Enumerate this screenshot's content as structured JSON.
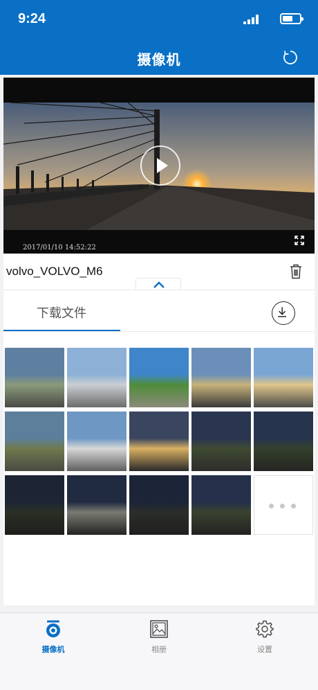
{
  "status_bar": {
    "time": "9:24",
    "battery_level": 0.6
  },
  "header": {
    "title": "摄像机"
  },
  "video": {
    "timestamp": "2017/01/10  14:52:22"
  },
  "file": {
    "name": "volvo_VOLVO_M6"
  },
  "tabs": {
    "download_label": "下载文件"
  },
  "thumbnails": [
    {
      "top": "#5f7fa0",
      "mid": "#8a9a7a",
      "bottom": "#4a4a45"
    },
    {
      "top": "#8db1d6",
      "mid": "#c9cfd3",
      "bottom": "#6b6b6b"
    },
    {
      "top": "#3e86c9",
      "mid": "#4f8c3a",
      "bottom": "#8a8a7a"
    },
    {
      "top": "#6b8fb8",
      "mid": "#c7b27a",
      "bottom": "#3a3a3a"
    },
    {
      "top": "#7aa6d4",
      "mid": "#e0c58a",
      "bottom": "#4b4b48"
    },
    {
      "top": "#5d7f9c",
      "mid": "#6f7a4e",
      "bottom": "#4a4a42"
    },
    {
      "top": "#6f97c4",
      "mid": "#d7d7d7",
      "bottom": "#5f5f5f"
    },
    {
      "top": "#3a4660",
      "mid": "#d9b062",
      "bottom": "#2a2a2a"
    },
    {
      "top": "#2a3550",
      "mid": "#3f4a32",
      "bottom": "#2d2d2b"
    },
    {
      "top": "#27344d",
      "mid": "#34402c",
      "bottom": "#252523"
    },
    {
      "top": "#1d2535",
      "mid": "#2a2f26",
      "bottom": "#1e1e1c"
    },
    {
      "top": "#202a40",
      "mid": "#7a7a72",
      "bottom": "#232323"
    },
    {
      "top": "#1c2438",
      "mid": "#2b2e2a",
      "bottom": "#1f1f1f"
    },
    {
      "top": "#25304a",
      "mid": "#3a4230",
      "bottom": "#222220"
    }
  ],
  "tabbar": {
    "items": [
      {
        "label": "摄像机",
        "icon": "camera-icon",
        "active": true
      },
      {
        "label": "相册",
        "icon": "album-icon",
        "active": false
      },
      {
        "label": "设置",
        "icon": "settings-gear-icon",
        "active": false
      }
    ]
  },
  "colors": {
    "primary": "#0a70c6"
  }
}
